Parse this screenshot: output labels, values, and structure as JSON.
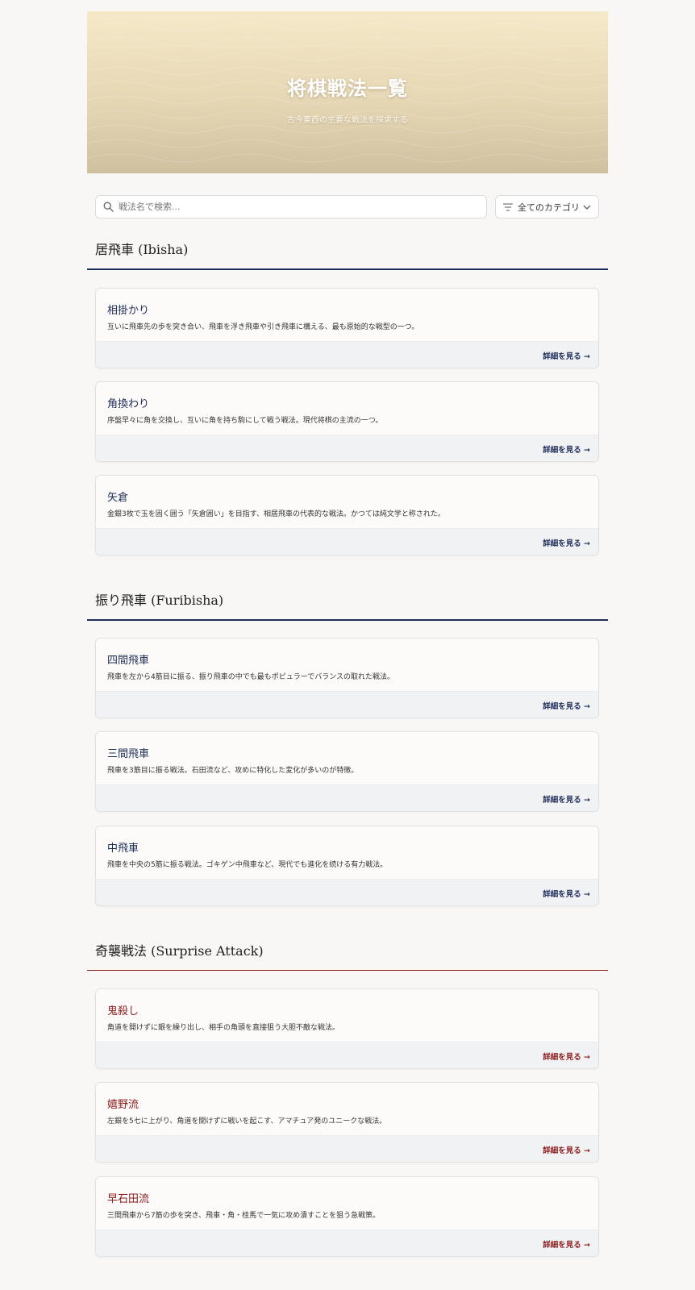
{
  "hero": {
    "title": "将棋戦法一覧",
    "subtitle": "古今東西の主要な戦法を探求する"
  },
  "search": {
    "placeholder": "戦法名で検索...",
    "icon": "search-icon"
  },
  "filter": {
    "selected": "全てのカテゴリ",
    "icon": "filter-icon",
    "chevron": "chevron-down-icon"
  },
  "colors": {
    "navy": "#1f2d5a",
    "crimson": "#8b1d1d"
  },
  "sections": [
    {
      "title": "居飛車 (Ibisha)",
      "accent": "#1f2d5a",
      "cards": [
        {
          "title": "相掛かり",
          "desc": "互いに飛車先の歩を突き合い、飛車を浮き飛車や引き飛車に構える、最も原始的な戦型の一つ。",
          "link": "詳細を見る →"
        },
        {
          "title": "角換わり",
          "desc": "序盤早々に角を交換し、互いに角を持ち駒にして戦う戦法。現代将棋の主流の一つ。",
          "link": "詳細を見る →"
        },
        {
          "title": "矢倉",
          "desc": "金銀3枚で玉を固く囲う「矢倉囲い」を目指す、相居飛車の代表的な戦法。かつては純文学と称された。",
          "link": "詳細を見る →"
        }
      ]
    },
    {
      "title": "振り飛車 (Furibisha)",
      "accent": "#1f2d5a",
      "cards": [
        {
          "title": "四間飛車",
          "desc": "飛車を左から4筋目に振る、振り飛車の中でも最もポピュラーでバランスの取れた戦法。",
          "link": "詳細を見る →"
        },
        {
          "title": "三間飛車",
          "desc": "飛車を3筋目に振る戦法。石田流など、攻めに特化した変化が多いのが特徴。",
          "link": "詳細を見る →"
        },
        {
          "title": "中飛車",
          "desc": "飛車を中央の5筋に振る戦法。ゴキゲン中飛車など、現代でも進化を続ける有力戦法。",
          "link": "詳細を見る →"
        }
      ]
    },
    {
      "title": "奇襲戦法 (Surprise Attack)",
      "accent": "#8b1d1d",
      "cards": [
        {
          "title": "鬼殺し",
          "desc": "角道を開けずに銀を繰り出し、相手の角頭を直接狙う大胆不敵な戦法。",
          "link": "詳細を見る →"
        },
        {
          "title": "嬉野流",
          "desc": "左銀を5七に上がり、角道を開けずに戦いを起こす、アマチュア発のユニークな戦法。",
          "link": "詳細を見る →"
        },
        {
          "title": "早石田流",
          "desc": "三間飛車から7筋の歩を突き、飛車・角・桂馬で一気に攻め潰すことを狙う急戦策。",
          "link": "詳細を見る →"
        }
      ]
    }
  ]
}
